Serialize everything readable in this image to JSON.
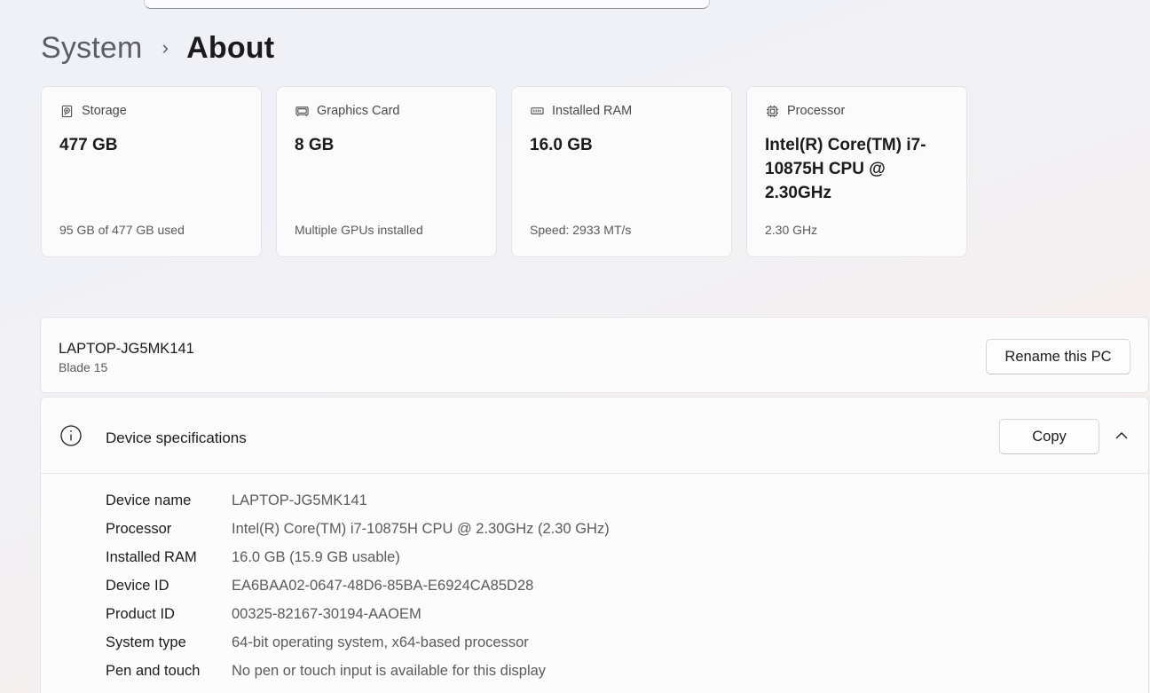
{
  "breadcrumb": {
    "parent": "System",
    "separator": "›",
    "current": "About"
  },
  "cards": [
    {
      "icon": "storage-icon",
      "label": "Storage",
      "value": "477 GB",
      "sub": "95 GB of 477 GB used"
    },
    {
      "icon": "graphics-card-icon",
      "label": "Graphics Card",
      "value": "8 GB",
      "sub": "Multiple GPUs installed"
    },
    {
      "icon": "ram-icon",
      "label": "Installed RAM",
      "value": "16.0 GB",
      "sub": "Speed: 2933 MT/s"
    },
    {
      "icon": "processor-icon",
      "label": "Processor",
      "value": "Intel(R) Core(TM) i7-10875H CPU @ 2.30GHz",
      "sub": "2.30 GHz"
    }
  ],
  "pc": {
    "name": "LAPTOP-JG5MK141",
    "model": "Blade 15",
    "rename_label": "Rename this PC"
  },
  "specs": {
    "title": "Device specifications",
    "copy_label": "Copy",
    "rows": [
      {
        "key": "Device name",
        "value": "LAPTOP-JG5MK141"
      },
      {
        "key": "Processor",
        "value": "Intel(R) Core(TM) i7-10875H CPU @ 2.30GHz (2.30 GHz)"
      },
      {
        "key": "Installed RAM",
        "value": "16.0 GB (15.9 GB usable)"
      },
      {
        "key": "Device ID",
        "value": "EA6BAA02-0647-48D6-85BA-E6924CA85D28"
      },
      {
        "key": "Product ID",
        "value": "00325-82167-30194-AAOEM"
      },
      {
        "key": "System type",
        "value": "64-bit operating system, x64-based processor"
      },
      {
        "key": "Pen and touch",
        "value": "No pen or touch input is available for this display"
      }
    ]
  }
}
